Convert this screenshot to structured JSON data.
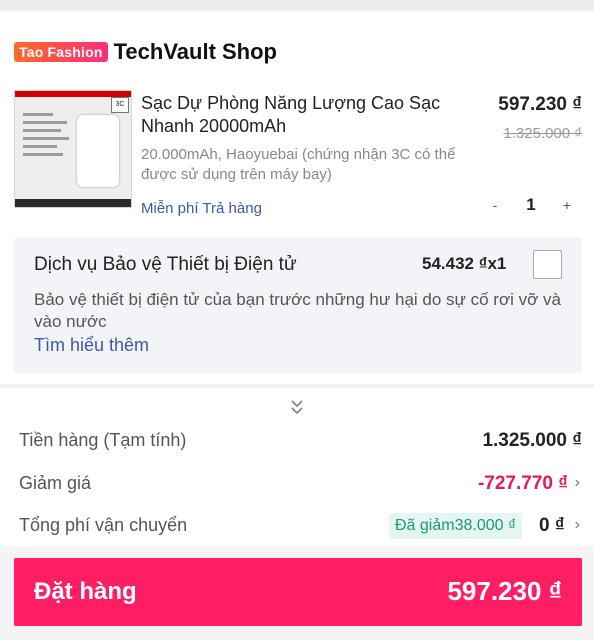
{
  "shop": {
    "badge": "Tao Fashion",
    "name": "TechVault Shop"
  },
  "product": {
    "title": "Sạc Dự Phòng Năng Lượng Cao Sạc Nhanh 20000mAh",
    "variant": "20.000mAh, Haoyuebai (chứng nhận 3C có thể được sử dụng trên máy bay)",
    "free_return": "Miễn phí Trả hàng",
    "price": "597.230 ₫",
    "old_price": "1.325.000 ₫",
    "quantity": "1",
    "minus": "-",
    "plus": "+"
  },
  "service": {
    "title": "Dịch vụ Bảo vệ Thiết bị Điện tử",
    "price_qty": "54.432 ₫x1",
    "description": "Bảo vệ thiết bị điện tử của bạn trước những hư hại do sự cố rơi vỡ và vào nước",
    "learn_more": "Tìm hiểu thêm"
  },
  "summary": {
    "subtotal_label": "Tiền hàng (Tạm tính)",
    "subtotal_value": "1.325.000 ₫",
    "discount_label": "Giảm giá",
    "discount_value": "-727.770 ₫",
    "shipping_label": "Tổng phí vận chuyển",
    "shipping_discount_tag": "Đã giảm38.000 ₫",
    "shipping_value": "0 ₫"
  },
  "order": {
    "button_label": "Đặt hàng",
    "total": "597.230 ₫"
  },
  "icons": {
    "expand": "chevron-double-down-icon",
    "arrow": "chevron-right-icon"
  },
  "colors": {
    "accent": "#ff1e64",
    "link": "#3d5aa8",
    "discount": "#e8185a",
    "tag_bg": "#e5f6f2",
    "tag_text": "#1a9a7a"
  }
}
